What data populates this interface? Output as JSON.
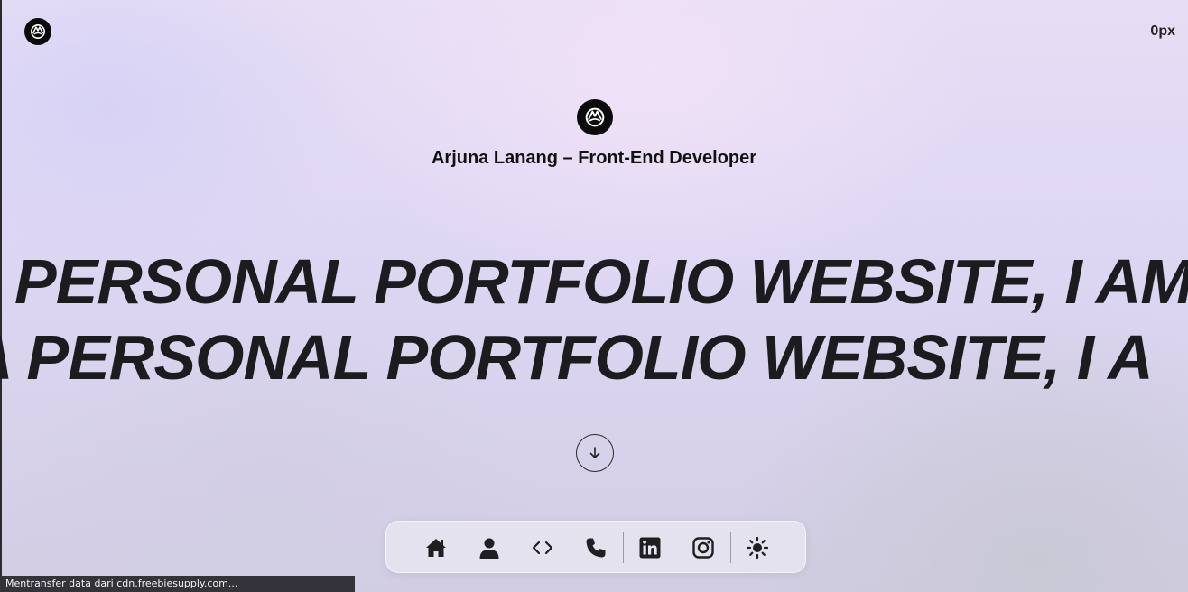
{
  "header": {
    "logo_icon": "brand-logo-icon",
    "scroll_readout": "0px"
  },
  "hero": {
    "logo_icon": "brand-logo-icon",
    "title": "Arjuna Lanang – Front-End Developer"
  },
  "marquee": {
    "line1": "PERSONAL PORTFOLIO WEBSITE, I AM",
    "line2": "A PERSONAL PORTFOLIO WEBSITE, I A"
  },
  "scroll_button": {
    "icon": "arrow-down-icon"
  },
  "dock": {
    "items": [
      {
        "icon": "home-icon"
      },
      {
        "icon": "user-icon"
      },
      {
        "icon": "code-icon"
      },
      {
        "icon": "phone-icon"
      },
      {
        "icon": "linkedin-icon"
      },
      {
        "icon": "instagram-icon"
      },
      {
        "icon": "sun-icon"
      }
    ]
  },
  "status_bar": {
    "text": "Mentransfer data dari cdn.freebiesupply.com..."
  },
  "colors": {
    "text": "#111111",
    "marquee_text": "#1c1c1e",
    "logo_bg": "#0b0b0b",
    "status_bar_bg": "#343438"
  }
}
